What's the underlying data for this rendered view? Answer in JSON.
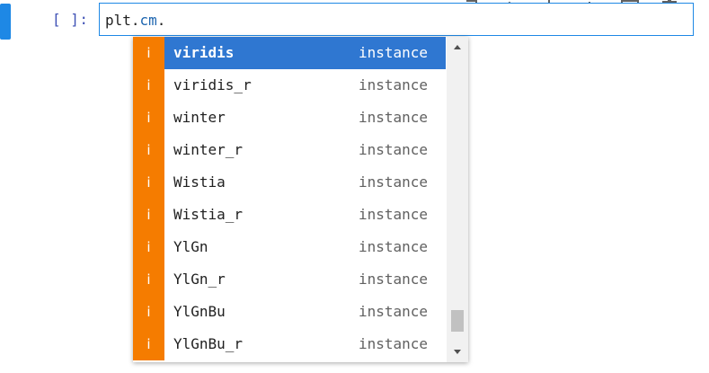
{
  "cell": {
    "prompt": "[ ]:",
    "code_object": "plt.",
    "code_attr": "cm",
    "code_dot": "."
  },
  "toolbar": {
    "buttons": [
      {
        "name": "duplicate-cell-icon"
      },
      {
        "name": "move-up-icon"
      },
      {
        "name": "move-down-icon"
      },
      {
        "name": "insert-above-icon"
      },
      {
        "name": "insert-below-icon"
      },
      {
        "name": "delete-cell-icon"
      }
    ]
  },
  "completer": {
    "items": [
      {
        "icon": "i",
        "label": "viridis",
        "kind": "instance",
        "active": true
      },
      {
        "icon": "i",
        "label": "viridis_r",
        "kind": "instance",
        "active": false
      },
      {
        "icon": "i",
        "label": "winter",
        "kind": "instance",
        "active": false
      },
      {
        "icon": "i",
        "label": "winter_r",
        "kind": "instance",
        "active": false
      },
      {
        "icon": "i",
        "label": "Wistia",
        "kind": "instance",
        "active": false
      },
      {
        "icon": "i",
        "label": "Wistia_r",
        "kind": "instance",
        "active": false
      },
      {
        "icon": "i",
        "label": "YlGn",
        "kind": "instance",
        "active": false
      },
      {
        "icon": "i",
        "label": "YlGn_r",
        "kind": "instance",
        "active": false
      },
      {
        "icon": "i",
        "label": "YlGnBu",
        "kind": "instance",
        "active": false
      },
      {
        "icon": "i",
        "label": "YlGnBu_r",
        "kind": "instance",
        "active": false
      }
    ]
  },
  "colors": {
    "accent": "#1e88e5",
    "selection": "#2f77d1",
    "type_icon": "#f57c00"
  }
}
